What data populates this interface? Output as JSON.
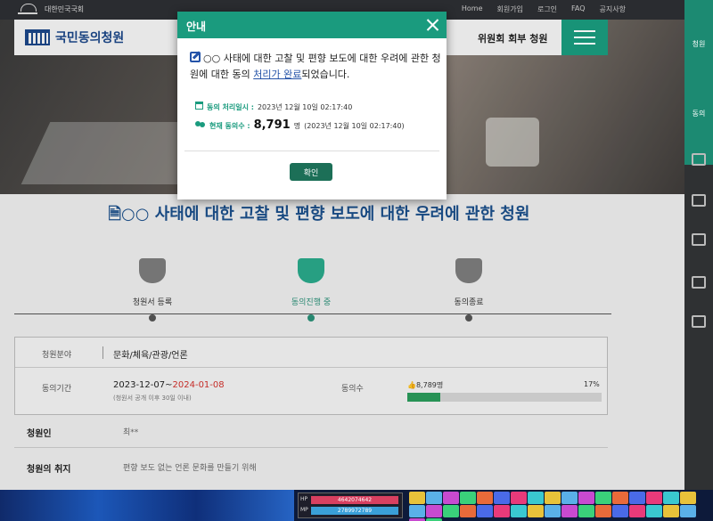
{
  "topbar": {
    "brand": "대한민국국회",
    "links": [
      "Home",
      "회원가입",
      "로그인",
      "FAQ",
      "공지사항"
    ]
  },
  "header": {
    "logo_text": "국민동의청원",
    "nav_item": "위원회 회부 청원"
  },
  "petition": {
    "title": "○○ 사태에 대한 고찰 및 편향 보도에 대한 우려에 관한 청원",
    "steps": [
      {
        "label": "청원서 등록",
        "active": false
      },
      {
        "label": "동의진행 중",
        "active": true
      },
      {
        "label": "동의종료",
        "active": false
      }
    ],
    "field_label": "청원분야",
    "field_value": "문화/체육/관광/언론",
    "period_label": "동의기간",
    "period_start": "2023-12-07",
    "period_sep": "~",
    "period_end": "2024-01-08",
    "period_note": "(청원서 공개 이후 30일 이내)",
    "count_label": "동의수",
    "count_value": "8,789명",
    "progress_label": "17%",
    "progress_fraction": 0.17,
    "petitioner_label": "청원인",
    "petitioner_value": "최**",
    "purpose_label": "청원의 취지",
    "purpose_value": "편향 보도 없는 언론 문화를 만들기 위해"
  },
  "sidebar": {
    "items": [
      "청원",
      "동의"
    ]
  },
  "modal": {
    "title": "안내",
    "message_before": "○○ 사태에 대한 고찰 및 편향 보도에 대한 우려에 관한 청원에 대한 동의 ",
    "message_link": "처리가 완료",
    "message_after": "되었습니다.",
    "processed_label": "동의 처리일시 :",
    "processed_value": "2023년 12월 10일 02:17:40",
    "count_label": "현재 동의수 :",
    "count_number": "8,791",
    "count_unit": "명",
    "count_time": "(2023년 12월 10일 02:17:40)",
    "confirm_label": "확인"
  },
  "taskbar": {
    "hp_label": "HP",
    "hp_value": "4642074642",
    "mp_label": "MP",
    "mp_value": "2789972789"
  },
  "colors": {
    "accent": "#1a9b7e",
    "title_blue": "#1b4f8a",
    "red": "#d0302b",
    "progress": "#2a9a5a"
  },
  "icons": [
    "edit-icon",
    "calendar-icon",
    "users-icon",
    "close-icon",
    "menu-icon",
    "document-icon"
  ]
}
